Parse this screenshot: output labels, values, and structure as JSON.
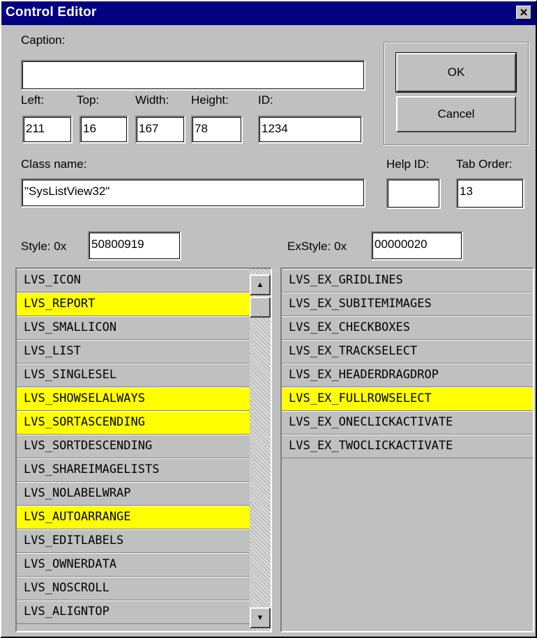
{
  "window": {
    "title": "Control Editor",
    "close_glyph": "✕",
    "close_icon": "close-icon"
  },
  "labels": {
    "caption": "Caption:",
    "left": "Left:",
    "top": "Top:",
    "width": "Width:",
    "height": "Height:",
    "id": "ID:",
    "class_name": "Class name:",
    "help_id": "Help ID:",
    "tab_order": "Tab Order:",
    "style": "Style:  0x",
    "exstyle": "ExStyle:  0x"
  },
  "fields": {
    "caption": "",
    "left": "211",
    "top": "16",
    "width": "167",
    "height": "78",
    "id": "1234",
    "class_name": "\"SysListView32\"",
    "help_id": "",
    "tab_order": "13",
    "style": "50800919",
    "exstyle": "00000020"
  },
  "buttons": {
    "ok": "OK",
    "cancel": "Cancel"
  },
  "style_list": [
    {
      "label": "LVS_ICON",
      "selected": false
    },
    {
      "label": "LVS_REPORT",
      "selected": true
    },
    {
      "label": "LVS_SMALLICON",
      "selected": false
    },
    {
      "label": "LVS_LIST",
      "selected": false
    },
    {
      "label": "LVS_SINGLESEL",
      "selected": false
    },
    {
      "label": "LVS_SHOWSELALWAYS",
      "selected": true
    },
    {
      "label": "LVS_SORTASCENDING",
      "selected": true
    },
    {
      "label": "LVS_SORTDESCENDING",
      "selected": false
    },
    {
      "label": "LVS_SHAREIMAGELISTS",
      "selected": false
    },
    {
      "label": "LVS_NOLABELWRAP",
      "selected": false
    },
    {
      "label": "LVS_AUTOARRANGE",
      "selected": true
    },
    {
      "label": "LVS_EDITLABELS",
      "selected": false
    },
    {
      "label": "LVS_OWNERDATA",
      "selected": false
    },
    {
      "label": "LVS_NOSCROLL",
      "selected": false
    },
    {
      "label": "LVS_ALIGNTOP",
      "selected": false
    }
  ],
  "exstyle_list": [
    {
      "label": "LVS_EX_GRIDLINES",
      "selected": false
    },
    {
      "label": "LVS_EX_SUBITEMIMAGES",
      "selected": false
    },
    {
      "label": "LVS_EX_CHECKBOXES",
      "selected": false
    },
    {
      "label": "LVS_EX_TRACKSELECT",
      "selected": false
    },
    {
      "label": "LVS_EX_HEADERDRAGDROP",
      "selected": false
    },
    {
      "label": "LVS_EX_FULLROWSELECT",
      "selected": true
    },
    {
      "label": "LVS_EX_ONECLICKACTIVATE",
      "selected": false
    },
    {
      "label": "LVS_EX_TWOCLICKACTIVATE",
      "selected": false
    }
  ],
  "scrollbar": {
    "up_glyph": "▲",
    "down_glyph": "▼"
  },
  "colors": {
    "titlebar": "#000080",
    "highlight": "#ffff00",
    "face": "#c0c0c0"
  }
}
